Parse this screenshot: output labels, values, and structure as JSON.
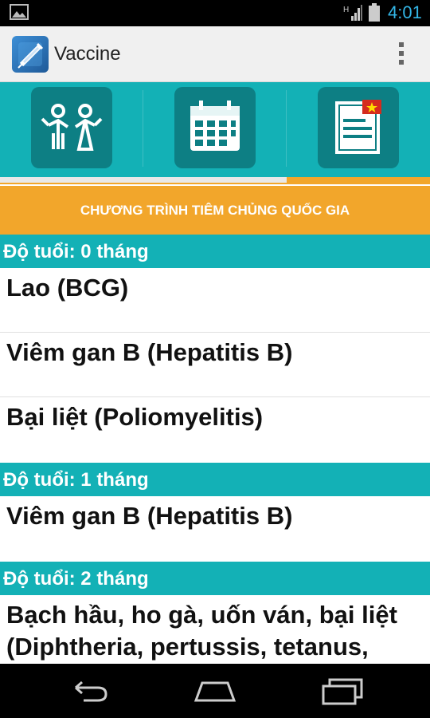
{
  "status_bar": {
    "time": "4:01",
    "icons": [
      "gallery-icon",
      "signal-icon",
      "battery-icon"
    ],
    "time_color": "#33b5e5"
  },
  "action_bar": {
    "title": "Vaccine",
    "app_icon": "syringe-icon",
    "menu_icon": "overflow-menu-icon"
  },
  "tabs": [
    {
      "icon": "family-icon"
    },
    {
      "icon": "calendar-icon"
    },
    {
      "icon": "flag-document-icon",
      "selected": true
    }
  ],
  "banner": "CHƯƠNG TRÌNH TIÊM CHỦNG QUỐC GIA",
  "schedule": [
    {
      "age": "Độ tuổi: 0 tháng",
      "vaccines": [
        "Lao (BCG)",
        "Viêm gan B (Hepatitis B)",
        "Bại liệt (Poliomyelitis)"
      ]
    },
    {
      "age": "Độ tuổi: 1 tháng",
      "vaccines": [
        "Viêm gan B (Hepatitis B)"
      ]
    },
    {
      "age": "Độ tuổi: 2 tháng",
      "vaccines": [
        "Bạch hầu, ho gà, uốn ván, bại liệt (Diphtheria, pertussis, tetanus,"
      ]
    }
  ],
  "nav_bar": {
    "buttons": [
      "back-icon",
      "home-icon",
      "recent-apps-icon"
    ]
  },
  "colors": {
    "teal": "#13b1b6",
    "teal_dark": "#0d7f84",
    "orange": "#f2a62b"
  }
}
